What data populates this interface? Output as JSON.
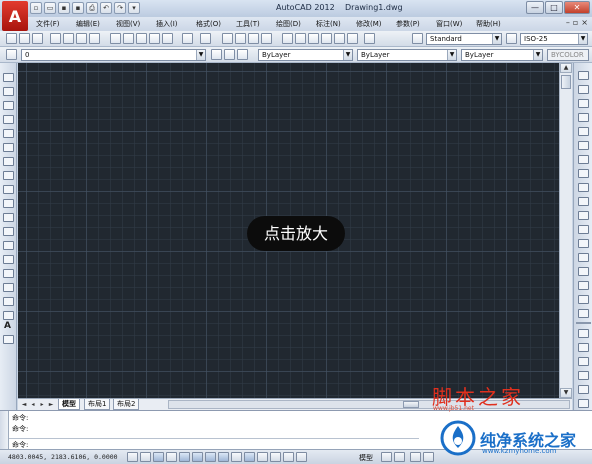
{
  "window": {
    "app_title": "AutoCAD 2012",
    "document": "Drawing1.dwg",
    "logo_letter": "A",
    "min": "—",
    "max": "□",
    "close": "✕"
  },
  "menu": [
    {
      "label": "文件(F)"
    },
    {
      "label": "编辑(E)"
    },
    {
      "label": "视图(V)"
    },
    {
      "label": "插入(I)"
    },
    {
      "label": "格式(O)"
    },
    {
      "label": "工具(T)"
    },
    {
      "label": "绘图(D)"
    },
    {
      "label": "标注(N)"
    },
    {
      "label": "修改(M)"
    },
    {
      "label": "参数(P)"
    },
    {
      "label": "窗口(W)"
    },
    {
      "label": "帮助(H)"
    }
  ],
  "toolbar1": {
    "text_style": "Standard",
    "dim_style": "ISO-25"
  },
  "toolbar2": {
    "layer": "0",
    "color": "ByLayer",
    "linetype": "ByLayer",
    "lineweight": "ByLayer",
    "plotstyle": "BYCOLOR"
  },
  "canvas": {
    "zoom_hint": "点击放大",
    "background": "#212830"
  },
  "tabs": {
    "model": "模型",
    "layout1": "布局1",
    "layout2": "布局2"
  },
  "command": {
    "line1": "命令:",
    "line2": "命令:",
    "prompt": "命令:"
  },
  "status": {
    "coords": "4803.0045, 2183.6106, 0.0000",
    "model": "模型"
  },
  "watermark": {
    "jb51": "脚本之家",
    "jb51_url": "www.jb51.net",
    "kzm": "纯净系统之家",
    "kzm_url": "www.kzmyhome.com"
  }
}
